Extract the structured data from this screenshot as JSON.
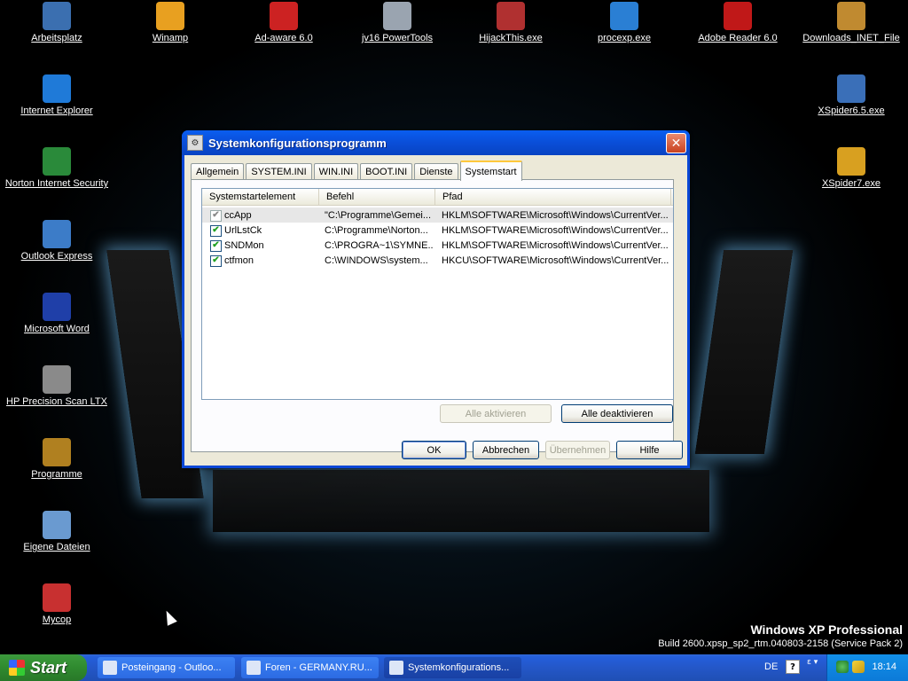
{
  "desktop": {
    "icons": [
      {
        "label": "Arbeitsplatz",
        "icon": "computer-icon",
        "color": "#3b6fb0"
      },
      {
        "label": "Winamp",
        "icon": "winamp-icon",
        "color": "#e8a020"
      },
      {
        "label": "Ad-aware 6.0",
        "icon": "adaware-icon",
        "color": "#cc2222"
      },
      {
        "label": "jv16 PowerTools",
        "icon": "bulb-icon",
        "color": "#9aa4b0"
      },
      {
        "label": "HijackThis.exe",
        "icon": "hijack-icon",
        "color": "#b03030"
      },
      {
        "label": "procexp.exe",
        "icon": "windows-flag-icon",
        "color": "#2a7fd4"
      },
      {
        "label": "Adobe Reader 6.0",
        "icon": "adobe-icon",
        "color": "#c01818"
      },
      {
        "label": "Downloads_INET_File",
        "icon": "folder-images-icon",
        "color": "#c08a30"
      },
      {
        "label": "Internet Explorer",
        "icon": "ie-icon",
        "color": "#1f7ad8"
      },
      {
        "label": "XSpider6.5.exe",
        "icon": "xspider-icon",
        "color": "#3a6fb8"
      },
      {
        "label": "Norton Internet Security",
        "icon": "globe-icon",
        "color": "#2a8a3a"
      },
      {
        "label": "XSpider7.exe",
        "icon": "xspider7-icon",
        "color": "#d8a020"
      },
      {
        "label": "Outlook Express",
        "icon": "outlook-icon",
        "color": "#3c7cc8"
      },
      {
        "label": "Microsoft Word",
        "icon": "word-icon",
        "color": "#1f3fa8"
      },
      {
        "label": "HP Precision Scan LTX",
        "icon": "scanner-icon",
        "color": "#8a8a8a"
      },
      {
        "label": "Programme",
        "icon": "programs-icon",
        "color": "#b08020"
      },
      {
        "label": "Eigene Dateien",
        "icon": "documents-icon",
        "color": "#6a9ad0"
      },
      {
        "label": "Mycop",
        "icon": "mycop-icon",
        "color": "#c83030"
      }
    ],
    "brand_title": "Windows XP Professional",
    "brand_build": "Build 2600.xpsp_sp2_rtm.040803-2158 (Service Pack 2)"
  },
  "dialog": {
    "title": "Systemkonfigurationsprogramm",
    "close_glyph": "✕",
    "tabs": [
      "Allgemein",
      "SYSTEM.INI",
      "WIN.INI",
      "BOOT.INI",
      "Dienste",
      "Systemstart"
    ],
    "active_tab": "Systemstart",
    "columns": [
      "Systemstartelement",
      "Befehl",
      "Pfad"
    ],
    "rows": [
      {
        "name": "ccApp",
        "command": "\"C:\\Programme\\Gemei...",
        "path": "HKLM\\SOFTWARE\\Microsoft\\Windows\\CurrentVer...",
        "checked": true,
        "selected": true
      },
      {
        "name": "UrlLstCk",
        "command": "C:\\Programme\\Norton...",
        "path": "HKLM\\SOFTWARE\\Microsoft\\Windows\\CurrentVer...",
        "checked": true,
        "selected": false
      },
      {
        "name": "SNDMon",
        "command": "C:\\PROGRA~1\\SYMNE...",
        "path": "HKLM\\SOFTWARE\\Microsoft\\Windows\\CurrentVer...",
        "checked": true,
        "selected": false
      },
      {
        "name": "ctfmon",
        "command": "C:\\WINDOWS\\system...",
        "path": "HKCU\\SOFTWARE\\Microsoft\\Windows\\CurrentVer...",
        "checked": true,
        "selected": false
      }
    ],
    "check_glyph": "✔",
    "enable_all_label": "Alle aktivieren",
    "disable_all_label": "Alle deaktivieren",
    "ok_label": "OK",
    "cancel_label": "Abbrechen",
    "apply_label": "Übernehmen",
    "help_label": "Hilfe"
  },
  "taskbar": {
    "start_label": "Start",
    "tasks": [
      {
        "label": "Posteingang - Outloo...",
        "active": false
      },
      {
        "label": "Foren - GERMANY.RU...",
        "active": false
      },
      {
        "label": "Systemkonfigurations...",
        "active": true
      }
    ],
    "language": "DE",
    "help_glyph": "?",
    "tray_arrows": "ε ▾",
    "clock": "18:14"
  }
}
